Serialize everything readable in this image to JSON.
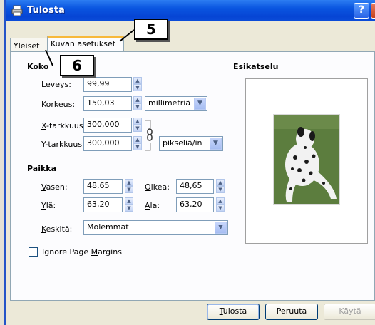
{
  "window": {
    "title": "Tulosta",
    "help_btn": "?",
    "close_btn": "X"
  },
  "tabs": [
    {
      "label": "Yleiset"
    },
    {
      "label": "Kuvan asetukset"
    }
  ],
  "size": {
    "heading": "Koko",
    "width": {
      "label": "Leveys:",
      "value": "99,99"
    },
    "height": {
      "label": "Korkeus:",
      "value": "150,03"
    },
    "unit": "millimetriä",
    "x_res": {
      "label": "X-tarkkuus:",
      "value": "300,000"
    },
    "y_res": {
      "label": "Y-tarkkuus:",
      "value": "300,000"
    },
    "res_unit": "pikseliä/in"
  },
  "position": {
    "heading": "Paikka",
    "left": {
      "label": "Vasen:",
      "value": "48,65"
    },
    "right": {
      "label": "Oikea:",
      "value": "48,65"
    },
    "top": {
      "label": "Ylä:",
      "value": "63,20"
    },
    "bottom": {
      "label": "Ala:",
      "value": "63,20"
    },
    "center": {
      "label": "Keskitä:",
      "value": "Molemmat"
    }
  },
  "ignore_margins": {
    "label": "Ignore Page Margins",
    "checked": false
  },
  "preview": {
    "heading": "Esikatselu"
  },
  "buttons": {
    "print": "Tulosta",
    "cancel": "Peruuta",
    "apply": "Käytä"
  },
  "callouts": {
    "five": "5",
    "six": "6"
  }
}
